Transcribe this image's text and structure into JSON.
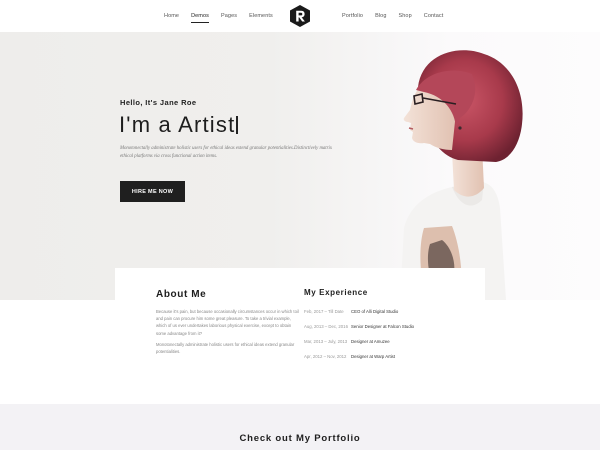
{
  "nav": {
    "left_items": [
      {
        "label": "Home",
        "active": false
      },
      {
        "label": "Demos",
        "active": true
      },
      {
        "label": "Pages",
        "active": false
      },
      {
        "label": "Elements",
        "active": false
      }
    ],
    "right_items": [
      {
        "label": "Portfolio",
        "active": false
      },
      {
        "label": "Blog",
        "active": false
      },
      {
        "label": "Shop",
        "active": false
      },
      {
        "label": "Contact",
        "active": false
      }
    ],
    "logo_icon": "r-logo-icon"
  },
  "hero": {
    "greeting": "Hello, It's Jane Roe",
    "title": "I'm a Artist",
    "description": "Monotonectally administrate holistic users for ethical ideas extend granular potentialities.Distinctively matrix ethical platforms via cross functional action items.",
    "button_label": "HIRE ME NOW"
  },
  "about": {
    "title": "About Me",
    "paragraphs": [
      "Because it's pain, but because occasionally circumstances occur in which toil and pain can procure him some great pleasure. To take a trivial example, which of us ever undertakes laborious physical exercise, except to obtain some advantage from it?",
      "Monotonectally administrate holistic users for ethical ideas extend granular potentialities."
    ]
  },
  "experience": {
    "title": "My Experience",
    "items": [
      {
        "date": "Feb, 2017 – Till Date",
        "role": "CEO of Alli Digital Studio"
      },
      {
        "date": "Aug, 2013 – Dec, 2016",
        "role": "Senior Designer at Falcon Studio"
      },
      {
        "date": "Mar, 2013 – July, 2013",
        "role": "Designer at Amuzee"
      },
      {
        "date": "Apr, 2012 – Nov, 2012",
        "role": "Designer at Warp Artist"
      }
    ]
  },
  "portfolio": {
    "title": "Check out My Portfolio"
  },
  "colors": {
    "dark": "#1f1f1f",
    "hair": "#b2404f",
    "hero_bg": "#efeeec",
    "section_bg": "#f3f2f5"
  }
}
